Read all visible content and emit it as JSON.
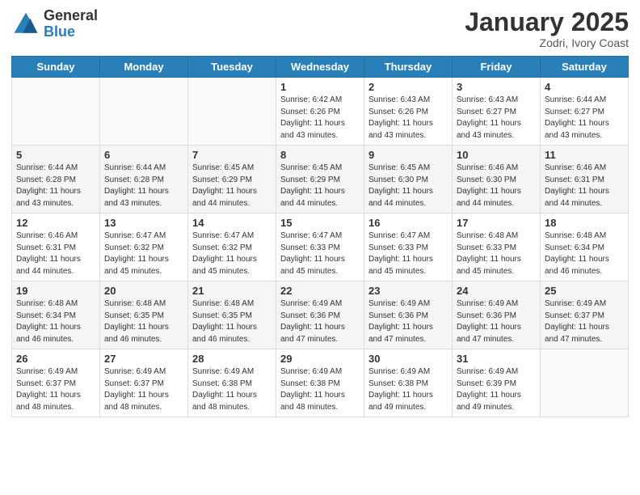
{
  "header": {
    "logo_general": "General",
    "logo_blue": "Blue",
    "month": "January 2025",
    "location": "Zodri, Ivory Coast"
  },
  "days_of_week": [
    "Sunday",
    "Monday",
    "Tuesday",
    "Wednesday",
    "Thursday",
    "Friday",
    "Saturday"
  ],
  "weeks": [
    [
      {
        "day": "",
        "info": ""
      },
      {
        "day": "",
        "info": ""
      },
      {
        "day": "",
        "info": ""
      },
      {
        "day": "1",
        "info": "Sunrise: 6:42 AM\nSunset: 6:26 PM\nDaylight: 11 hours and 43 minutes."
      },
      {
        "day": "2",
        "info": "Sunrise: 6:43 AM\nSunset: 6:26 PM\nDaylight: 11 hours and 43 minutes."
      },
      {
        "day": "3",
        "info": "Sunrise: 6:43 AM\nSunset: 6:27 PM\nDaylight: 11 hours and 43 minutes."
      },
      {
        "day": "4",
        "info": "Sunrise: 6:44 AM\nSunset: 6:27 PM\nDaylight: 11 hours and 43 minutes."
      }
    ],
    [
      {
        "day": "5",
        "info": "Sunrise: 6:44 AM\nSunset: 6:28 PM\nDaylight: 11 hours and 43 minutes."
      },
      {
        "day": "6",
        "info": "Sunrise: 6:44 AM\nSunset: 6:28 PM\nDaylight: 11 hours and 43 minutes."
      },
      {
        "day": "7",
        "info": "Sunrise: 6:45 AM\nSunset: 6:29 PM\nDaylight: 11 hours and 44 minutes."
      },
      {
        "day": "8",
        "info": "Sunrise: 6:45 AM\nSunset: 6:29 PM\nDaylight: 11 hours and 44 minutes."
      },
      {
        "day": "9",
        "info": "Sunrise: 6:45 AM\nSunset: 6:30 PM\nDaylight: 11 hours and 44 minutes."
      },
      {
        "day": "10",
        "info": "Sunrise: 6:46 AM\nSunset: 6:30 PM\nDaylight: 11 hours and 44 minutes."
      },
      {
        "day": "11",
        "info": "Sunrise: 6:46 AM\nSunset: 6:31 PM\nDaylight: 11 hours and 44 minutes."
      }
    ],
    [
      {
        "day": "12",
        "info": "Sunrise: 6:46 AM\nSunset: 6:31 PM\nDaylight: 11 hours and 44 minutes."
      },
      {
        "day": "13",
        "info": "Sunrise: 6:47 AM\nSunset: 6:32 PM\nDaylight: 11 hours and 45 minutes."
      },
      {
        "day": "14",
        "info": "Sunrise: 6:47 AM\nSunset: 6:32 PM\nDaylight: 11 hours and 45 minutes."
      },
      {
        "day": "15",
        "info": "Sunrise: 6:47 AM\nSunset: 6:33 PM\nDaylight: 11 hours and 45 minutes."
      },
      {
        "day": "16",
        "info": "Sunrise: 6:47 AM\nSunset: 6:33 PM\nDaylight: 11 hours and 45 minutes."
      },
      {
        "day": "17",
        "info": "Sunrise: 6:48 AM\nSunset: 6:33 PM\nDaylight: 11 hours and 45 minutes."
      },
      {
        "day": "18",
        "info": "Sunrise: 6:48 AM\nSunset: 6:34 PM\nDaylight: 11 hours and 46 minutes."
      }
    ],
    [
      {
        "day": "19",
        "info": "Sunrise: 6:48 AM\nSunset: 6:34 PM\nDaylight: 11 hours and 46 minutes."
      },
      {
        "day": "20",
        "info": "Sunrise: 6:48 AM\nSunset: 6:35 PM\nDaylight: 11 hours and 46 minutes."
      },
      {
        "day": "21",
        "info": "Sunrise: 6:48 AM\nSunset: 6:35 PM\nDaylight: 11 hours and 46 minutes."
      },
      {
        "day": "22",
        "info": "Sunrise: 6:49 AM\nSunset: 6:36 PM\nDaylight: 11 hours and 47 minutes."
      },
      {
        "day": "23",
        "info": "Sunrise: 6:49 AM\nSunset: 6:36 PM\nDaylight: 11 hours and 47 minutes."
      },
      {
        "day": "24",
        "info": "Sunrise: 6:49 AM\nSunset: 6:36 PM\nDaylight: 11 hours and 47 minutes."
      },
      {
        "day": "25",
        "info": "Sunrise: 6:49 AM\nSunset: 6:37 PM\nDaylight: 11 hours and 47 minutes."
      }
    ],
    [
      {
        "day": "26",
        "info": "Sunrise: 6:49 AM\nSunset: 6:37 PM\nDaylight: 11 hours and 48 minutes."
      },
      {
        "day": "27",
        "info": "Sunrise: 6:49 AM\nSunset: 6:37 PM\nDaylight: 11 hours and 48 minutes."
      },
      {
        "day": "28",
        "info": "Sunrise: 6:49 AM\nSunset: 6:38 PM\nDaylight: 11 hours and 48 minutes."
      },
      {
        "day": "29",
        "info": "Sunrise: 6:49 AM\nSunset: 6:38 PM\nDaylight: 11 hours and 48 minutes."
      },
      {
        "day": "30",
        "info": "Sunrise: 6:49 AM\nSunset: 6:38 PM\nDaylight: 11 hours and 49 minutes."
      },
      {
        "day": "31",
        "info": "Sunrise: 6:49 AM\nSunset: 6:39 PM\nDaylight: 11 hours and 49 minutes."
      },
      {
        "day": "",
        "info": ""
      }
    ]
  ]
}
